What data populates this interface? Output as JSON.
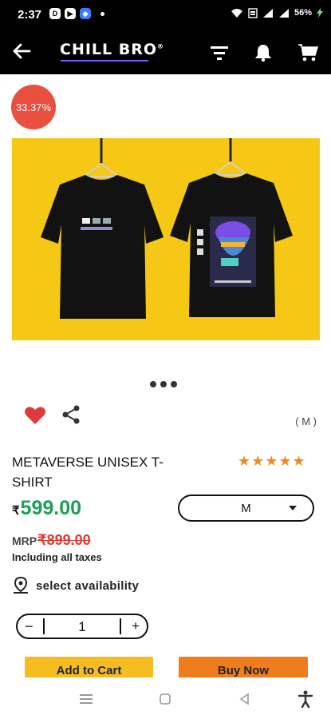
{
  "status": {
    "time": "2:37",
    "battery": "56%",
    "icons": [
      "d-icon",
      "youtube-icon",
      "app-icon",
      "notification-dot",
      "wifi-icon",
      "volte-icon",
      "signal-icon",
      "signal-icon-2"
    ]
  },
  "header": {
    "logo": "CHILL BRO",
    "logo_mark": "®",
    "icons": [
      "back-arrow-icon",
      "filter-icon",
      "bell-icon",
      "cart-icon"
    ]
  },
  "discount_badge": "33.37%",
  "carousel": {
    "count": 3,
    "active": 0
  },
  "actions": {
    "heart_icon": "heart-icon",
    "share_icon": "share-icon"
  },
  "selected_size_note": "( M )",
  "product": {
    "title": "METAVERSE UNISEX T-SHIRT",
    "rating_stars": 5,
    "stars": "★★★★★",
    "currency": "₹",
    "price": "599.00",
    "mrp_label": "MRP",
    "mrp_value": "₹899.00",
    "taxes_note": "Including all taxes"
  },
  "size_select": {
    "value": "M"
  },
  "availability": {
    "label": "select availability",
    "icon": "location-pin-icon"
  },
  "quantity": {
    "minus": "−",
    "value": "1",
    "plus": "+"
  },
  "buttons": {
    "add_to_cart": "Add to Cart",
    "buy_now": "Buy Now"
  },
  "colors": {
    "accent_green": "#1e9f57",
    "mrp_red": "#e03a2f",
    "badge_red": "#e94e3f",
    "add_cart_yellow": "#f6bd23",
    "buy_now_orange": "#f07d1c",
    "image_bg": "#f5c815"
  },
  "system_nav": [
    "recents-icon",
    "home-icon",
    "back-icon",
    "accessibility-icon"
  ]
}
